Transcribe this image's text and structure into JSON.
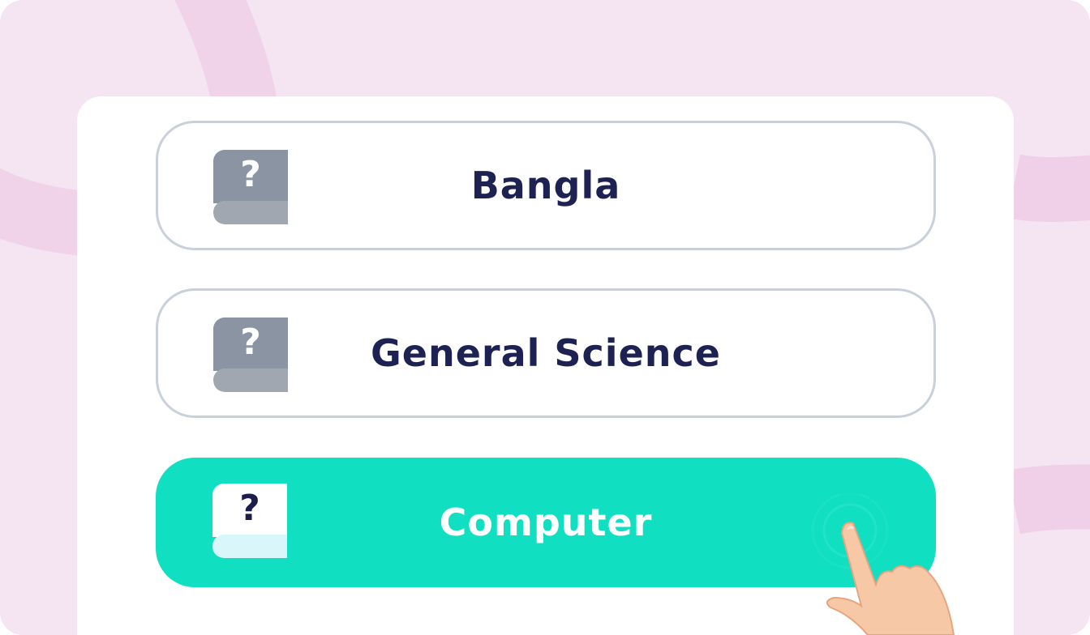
{
  "options": [
    {
      "label": "Bangla",
      "icon": "question-book-icon",
      "selected": false
    },
    {
      "label": "General Science",
      "icon": "question-book-icon",
      "selected": false
    },
    {
      "label": "Computer",
      "icon": "question-book-icon",
      "selected": true
    }
  ],
  "icon_glyph": "?",
  "colors": {
    "background": "#f5e4f2",
    "card": "#ffffff",
    "option_border": "#c9d0db",
    "selected": "#10dfc2",
    "text_dark": "#1e2252",
    "text_light": "#ffffff"
  },
  "pointer": "tapping-hand-icon"
}
